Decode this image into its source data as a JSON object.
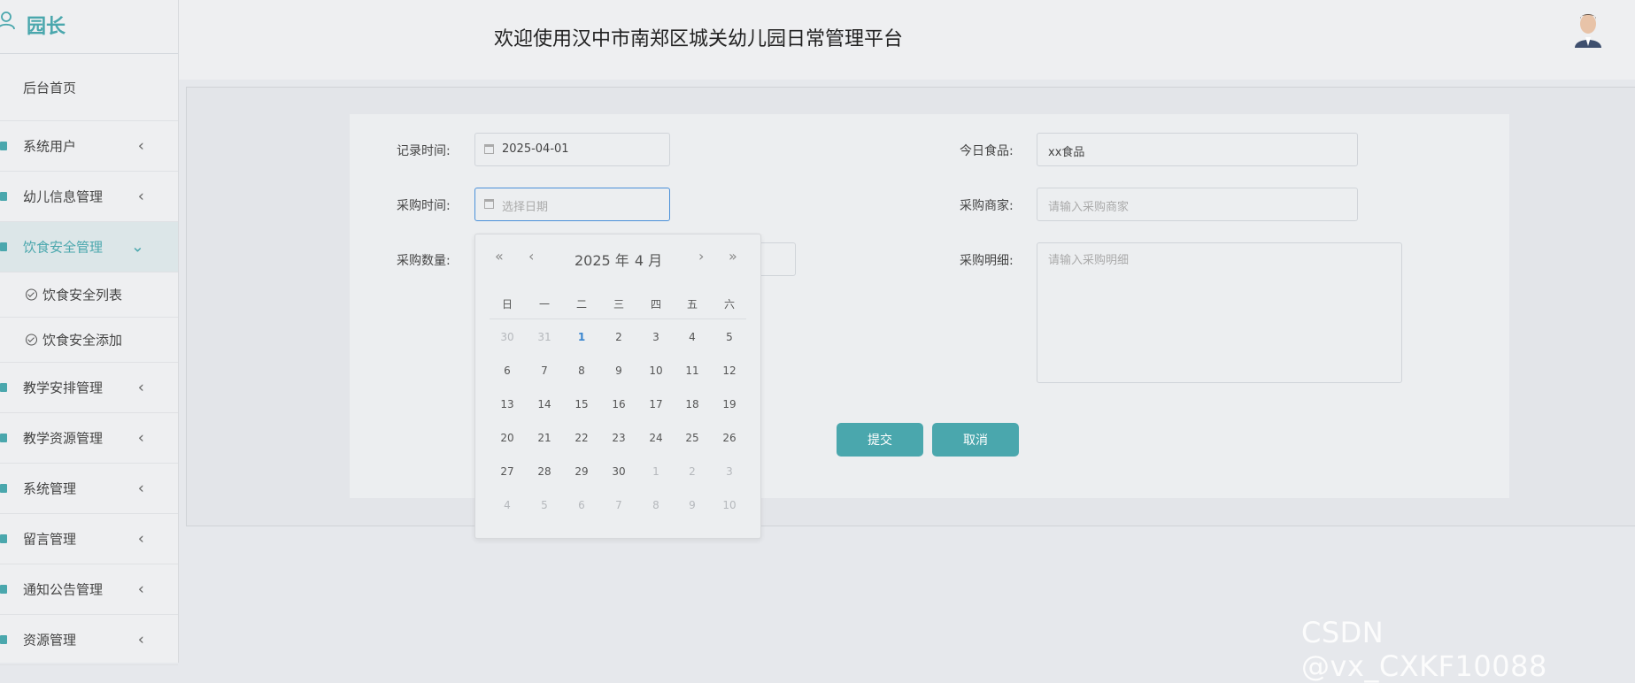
{
  "app": {
    "role": "园长",
    "header_title": "欢迎使用汉中市南郑区城关幼儿园日常管理平台"
  },
  "sidebar": {
    "home": "后台首页",
    "items": [
      {
        "label": "系统用户",
        "icon": "document-icon",
        "chevron": "‹"
      },
      {
        "label": "幼儿信息管理",
        "icon": "document-icon",
        "chevron": "‹"
      },
      {
        "label": "饮食安全管理",
        "icon": "document-icon",
        "chevron": "⌄",
        "active": true
      },
      {
        "label": "教学安排管理",
        "icon": "document-icon",
        "chevron": "‹"
      },
      {
        "label": "教学资源管理",
        "icon": "document-icon",
        "chevron": "‹"
      },
      {
        "label": "系统管理",
        "icon": "document-icon",
        "chevron": "‹"
      },
      {
        "label": "留言管理",
        "icon": "document-icon",
        "chevron": "‹"
      },
      {
        "label": "通知公告管理",
        "icon": "document-icon",
        "chevron": "‹"
      },
      {
        "label": "资源管理",
        "icon": "document-icon",
        "chevron": "‹"
      }
    ],
    "subitems": [
      {
        "label": "饮食安全列表",
        "icon": "check-circle-icon"
      },
      {
        "label": "饮食安全添加",
        "icon": "check-circle-icon"
      }
    ]
  },
  "form": {
    "record_time_label": "记录时间:",
    "record_time_value": "2025-04-01",
    "purchase_time_label": "采购时间:",
    "purchase_time_placeholder": "选择日期",
    "quantity_label": "采购数量:",
    "food_label": "今日食品:",
    "food_value": "xx食品",
    "merchant_label": "采购商家:",
    "merchant_placeholder": "请输入采购商家",
    "detail_label": "采购明细:",
    "detail_placeholder": "请输入采购明细",
    "submit": "提交",
    "cancel": "取消"
  },
  "datepicker": {
    "year": "2025 年",
    "month": "4 月",
    "nav_prev_year": "«",
    "nav_prev_month": "‹",
    "nav_next_month": "›",
    "nav_next_year": "»",
    "weekdays": [
      "日",
      "一",
      "二",
      "三",
      "四",
      "五",
      "六"
    ],
    "weeks": [
      [
        "30",
        "31",
        "1",
        "2",
        "3",
        "4",
        "5"
      ],
      [
        "6",
        "7",
        "8",
        "9",
        "10",
        "11",
        "12"
      ],
      [
        "13",
        "14",
        "15",
        "16",
        "17",
        "18",
        "19"
      ],
      [
        "20",
        "21",
        "22",
        "23",
        "24",
        "25",
        "26"
      ],
      [
        "27",
        "28",
        "29",
        "30",
        "1",
        "2",
        "3"
      ],
      [
        "4",
        "5",
        "6",
        "7",
        "8",
        "9",
        "10"
      ]
    ],
    "today": "1"
  },
  "watermark": "CSDN @vx_CXKF10088",
  "colors": {
    "accent": "#4aa7ad",
    "today": "#3a86cf"
  }
}
